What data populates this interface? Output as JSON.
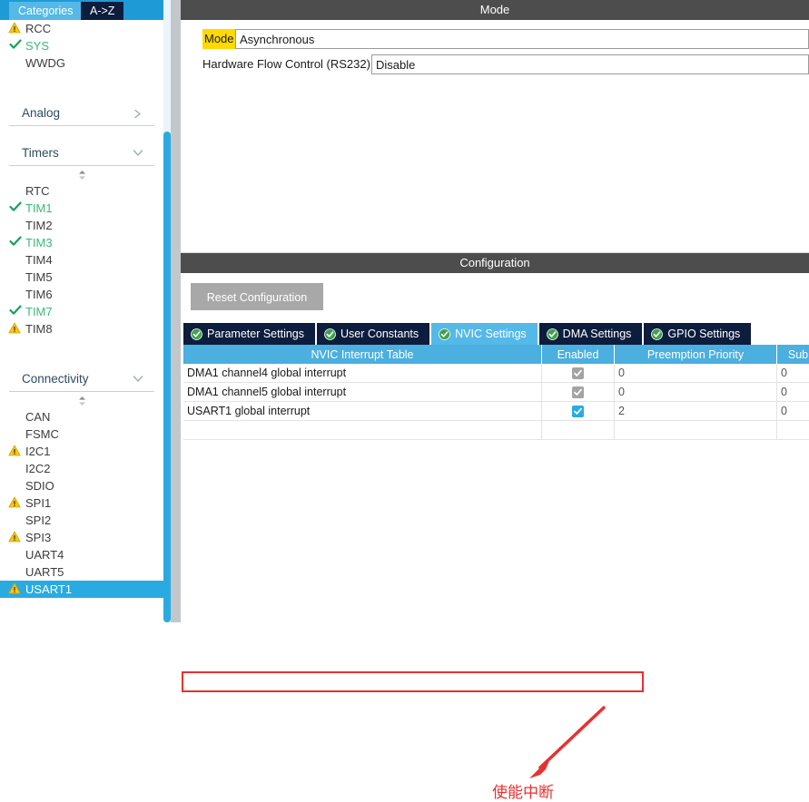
{
  "left_panel": {
    "tabs": [
      {
        "label": "Categories",
        "selected": true
      },
      {
        "label": "A->Z",
        "selected": false
      }
    ],
    "top_items": [
      {
        "label": "RCC",
        "status": "warn"
      },
      {
        "label": "SYS",
        "status": "ok"
      },
      {
        "label": "WWDG",
        "status": "none"
      }
    ],
    "categories": [
      {
        "name": "Analog",
        "chevron": "chevron-right-icon",
        "expanded": false,
        "items": []
      },
      {
        "name": "Timers",
        "chevron": "chevron-down-icon",
        "expanded": true,
        "items": [
          {
            "label": "RTC",
            "status": "none"
          },
          {
            "label": "TIM1",
            "status": "ok"
          },
          {
            "label": "TIM2",
            "status": "none"
          },
          {
            "label": "TIM3",
            "status": "ok"
          },
          {
            "label": "TIM4",
            "status": "none"
          },
          {
            "label": "TIM5",
            "status": "none"
          },
          {
            "label": "TIM6",
            "status": "none"
          },
          {
            "label": "TIM7",
            "status": "ok"
          },
          {
            "label": "TIM8",
            "status": "warn"
          }
        ]
      },
      {
        "name": "Connectivity",
        "chevron": "chevron-down-icon",
        "expanded": true,
        "items": [
          {
            "label": "CAN",
            "status": "none"
          },
          {
            "label": "FSMC",
            "status": "none"
          },
          {
            "label": "I2C1",
            "status": "warn"
          },
          {
            "label": "I2C2",
            "status": "none"
          },
          {
            "label": "SDIO",
            "status": "none"
          },
          {
            "label": "SPI1",
            "status": "warn"
          },
          {
            "label": "SPI2",
            "status": "none"
          },
          {
            "label": "SPI3",
            "status": "warn"
          },
          {
            "label": "UART4",
            "status": "none"
          },
          {
            "label": "UART5",
            "status": "none"
          },
          {
            "label": "USART1",
            "status": "warn",
            "selected": true
          }
        ]
      }
    ]
  },
  "mode_section": {
    "title": "Mode",
    "rows": [
      {
        "label": "Mode",
        "label_highlighted": true,
        "value": "Asynchronous"
      },
      {
        "label": "Hardware Flow Control (RS232)",
        "label_highlighted": false,
        "value": "Disable"
      }
    ]
  },
  "config_section": {
    "title": "Configuration",
    "reset_button": "Reset Configuration",
    "tabs": [
      {
        "label": "Parameter Settings",
        "active": false,
        "icon": "check-circle-icon"
      },
      {
        "label": "User Constants",
        "active": false,
        "icon": "check-circle-icon"
      },
      {
        "label": "NVIC Settings",
        "active": true,
        "icon": "check-circle-icon"
      },
      {
        "label": "DMA Settings",
        "active": false,
        "icon": "check-circle-icon"
      },
      {
        "label": "GPIO Settings",
        "active": false,
        "icon": "check-circle-icon"
      }
    ],
    "nvic_table": {
      "columns": [
        "NVIC Interrupt Table",
        "Enabled",
        "Preemption Priority",
        "Sub"
      ],
      "rows": [
        {
          "interrupt": "DMA1 channel4 global interrupt",
          "enabled": true,
          "enabled_style": "gray",
          "preemption_priority": "0",
          "sub_priority": "0"
        },
        {
          "interrupt": "DMA1 channel5 global interrupt",
          "enabled": true,
          "enabled_style": "gray",
          "preemption_priority": "0",
          "sub_priority": "0"
        },
        {
          "interrupt": "USART1 global interrupt",
          "enabled": true,
          "enabled_style": "blue",
          "preemption_priority": "2",
          "sub_priority": "0"
        }
      ]
    }
  },
  "annotation": {
    "text": "使能中断",
    "color": "#e8312f"
  },
  "colors": {
    "accent_blue": "#29abe2",
    "tab_selected": "#55b9e8",
    "tab_unselected": "#0d1d3d",
    "section_header": "#4d4d4d",
    "table_header": "#4bafe0",
    "warn_yellow": "#f5c518",
    "ok_green": "#15a05a",
    "highlight_yellow": "#ffd900",
    "annotation_red": "#e8312f"
  }
}
